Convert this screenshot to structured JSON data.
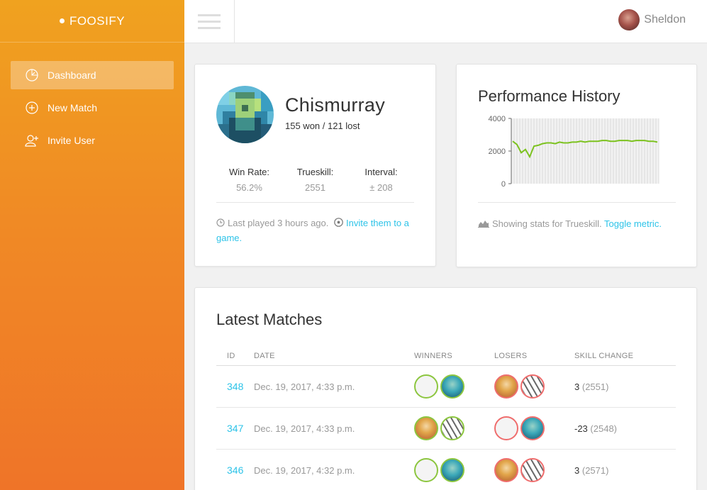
{
  "app": {
    "brand": "FOOSIFY"
  },
  "sidebar": {
    "items": [
      {
        "label": "Dashboard",
        "icon": "dashboard-gauge-icon",
        "active": true
      },
      {
        "label": "New Match",
        "icon": "plus-circle-icon",
        "active": false
      },
      {
        "label": "Invite User",
        "icon": "add-user-icon",
        "active": false
      }
    ]
  },
  "header": {
    "user_name": "Sheldon"
  },
  "profile": {
    "name": "Chismurray",
    "record": "155 won / 121 lost",
    "stats": [
      {
        "label": "Win Rate:",
        "value": "56.2%"
      },
      {
        "label": "Trueskill:",
        "value": "2551"
      },
      {
        "label": "Interval:",
        "value": "± 208"
      }
    ],
    "last_played": "Last played 3 hours ago.",
    "invite_link": "Invite them to a game."
  },
  "performance": {
    "title": "Performance History",
    "footer_text": "Showing stats for Trueskill.",
    "toggle_link": "Toggle metric."
  },
  "chart_data": {
    "type": "line",
    "ylim": [
      0,
      4000
    ],
    "yticks": [
      "4000",
      "2000",
      "0"
    ],
    "grid": true,
    "series": [
      {
        "values": [
          2600,
          2400,
          1900,
          2100,
          1650,
          2300,
          2350,
          2450,
          2500,
          2500,
          2450,
          2550,
          2500,
          2500,
          2550,
          2550,
          2600,
          2550,
          2600,
          2600,
          2600,
          2650,
          2650,
          2600,
          2600,
          2650,
          2650,
          2650,
          2600,
          2650,
          2650,
          2650,
          2600,
          2600,
          2550
        ]
      }
    ],
    "colors": {
      "line": "#7cc21f",
      "grid": "#cccccc",
      "bg": "#f2f2f2"
    }
  },
  "matches": {
    "title": "Latest Matches",
    "columns": [
      "ID",
      "DATE",
      "WINNERS",
      "LOSERS",
      "SKILL CHANGE"
    ],
    "rows": [
      {
        "id": "348",
        "date": "Dec. 19, 2017, 4:33 p.m.",
        "delta": "3",
        "total": "(2551)"
      },
      {
        "id": "347",
        "date": "Dec. 19, 2017, 4:33 p.m.",
        "delta": "-23",
        "total": "(2548)"
      },
      {
        "id": "346",
        "date": "Dec. 19, 2017, 4:32 p.m.",
        "delta": "3",
        "total": "(2571)"
      }
    ]
  },
  "colors": {
    "accent": "#2dc3e8",
    "sidebar_top": "#f0a21f",
    "sidebar_bottom": "#ef7428",
    "win_border": "#8cc63f",
    "lose_border": "#ef6d6d"
  }
}
